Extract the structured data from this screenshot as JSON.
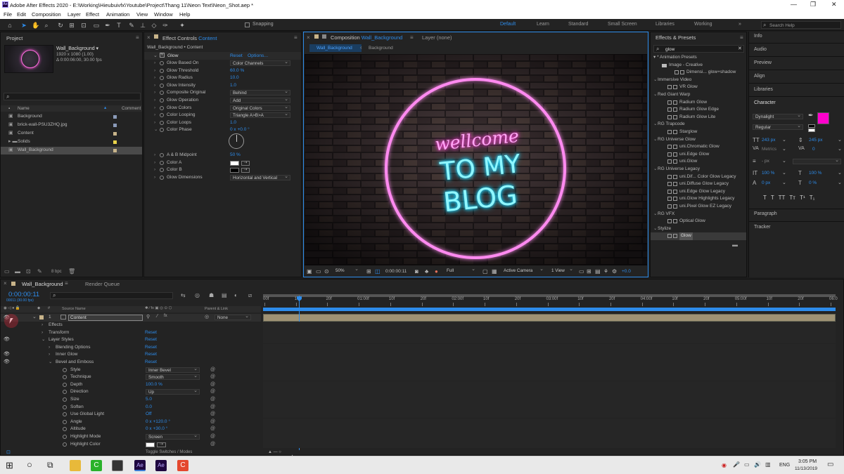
{
  "title_bar": {
    "text": "Adobe After Effects 2020 - E:\\Working\\Hieubuivfx\\Youtube\\Project\\Thang 11\\Neon Text\\Neon_Shot.aep *"
  },
  "menu": [
    "File",
    "Edit",
    "Composition",
    "Layer",
    "Effect",
    "Animation",
    "View",
    "Window",
    "Help"
  ],
  "toolbar": {
    "snapping": "Snapping",
    "workspaces": [
      "Default",
      "Learn",
      "Standard",
      "Small Screen",
      "Libraries",
      "Working"
    ],
    "search_placeholder": "Search Help"
  },
  "project": {
    "tab": "Project",
    "comp_name": "Wall_Background ▾",
    "comp_info1": "1920 x 1080 (1.00)",
    "comp_info2": "Δ 0:00:06:00, 30.00 fps",
    "col_name": "Name",
    "col_comment": "Comment",
    "items": [
      {
        "name": "Background",
        "color": "#8a9ab8"
      },
      {
        "name": "brick-wall-PSU3ZHQ.jpg",
        "color": "#8a9ab8"
      },
      {
        "name": "Content",
        "color": "#c8b48a"
      },
      {
        "name": "Solids",
        "color": "#e8d24a"
      },
      {
        "name": "Wall_Background",
        "color": "#c8b48a"
      }
    ],
    "bpc": "8 bpc"
  },
  "effect_controls": {
    "tab": "Effect Controls",
    "layer": "Content",
    "path": "Wall_Background • Content",
    "effect": "Glow",
    "reset": "Reset",
    "options": "Options...",
    "rows": [
      {
        "label": "Glow Based On",
        "value": "Color Channels",
        "kind": "dd"
      },
      {
        "label": "Glow Threshold",
        "value": "60.0 %",
        "kind": "val"
      },
      {
        "label": "Glow Radius",
        "value": "10.0",
        "kind": "val"
      },
      {
        "label": "Glow Intensity",
        "value": "1.0",
        "kind": "val"
      },
      {
        "label": "Composite Original",
        "value": "Behind",
        "kind": "dd"
      },
      {
        "label": "Glow Operation",
        "value": "Add",
        "kind": "dd"
      },
      {
        "label": "Glow Colors",
        "value": "Original Colors",
        "kind": "dd"
      },
      {
        "label": "Color Looping",
        "value": "Triangle A>B>A",
        "kind": "dd"
      },
      {
        "label": "Color Loops",
        "value": "1.0",
        "kind": "val"
      },
      {
        "label": "Color Phase",
        "value": "0 x +0.0 °",
        "kind": "val"
      }
    ],
    "rows2": [
      {
        "label": "A & B Midpoint",
        "value": "50 %",
        "kind": "val"
      },
      {
        "label": "Color A",
        "value": "",
        "kind": "swatch",
        "color": "#ffffff"
      },
      {
        "label": "Color B",
        "value": "",
        "kind": "swatch",
        "color": "#000000"
      },
      {
        "label": "Glow Dimensions",
        "value": "Horizontal and Vertical",
        "kind": "dd"
      }
    ]
  },
  "composition": {
    "tab_prefix": "Composition",
    "tab_name": "Wall_Background",
    "layer_tab": "Layer (none)",
    "crumbs": [
      "Wall_Background",
      "Background"
    ],
    "neon_line1": "wellcome",
    "neon_line2": "TO MY",
    "neon_line3": "BLOG",
    "zoom": "50%",
    "timecode": "0:00:00:11",
    "quality": "Full",
    "camera": "Active Camera",
    "views": "1 View",
    "exposure": "+0.0"
  },
  "effects_presets": {
    "tab": "Effects & Presets",
    "search": "glow",
    "tree": [
      {
        "t": "▾ * Animation Presets",
        "lvl": 0
      },
      {
        "t": "Image - Creative",
        "lvl": 1,
        "folder": true
      },
      {
        "t": "Dimensi... glow+shadow",
        "lvl": 2,
        "fx": true
      },
      {
        "t": "Immersive Video",
        "lvl": 0
      },
      {
        "t": "VR Glow",
        "lvl": 1,
        "fx": true
      },
      {
        "t": "Red Giant Warp",
        "lvl": 0
      },
      {
        "t": "Radium Glow",
        "lvl": 1,
        "fx": true
      },
      {
        "t": "Radium Glow Edge",
        "lvl": 1,
        "fx": true
      },
      {
        "t": "Radium Glow Lite",
        "lvl": 1,
        "fx": true
      },
      {
        "t": "RG Trapcode",
        "lvl": 0
      },
      {
        "t": "Starglow",
        "lvl": 1,
        "fx": true
      },
      {
        "t": "RG Universe Glow",
        "lvl": 0
      },
      {
        "t": "uni.Chromatic Glow",
        "lvl": 1,
        "fx": true
      },
      {
        "t": "uni.Edge Glow",
        "lvl": 1,
        "fx": true
      },
      {
        "t": "uni.Glow",
        "lvl": 1,
        "fx": true
      },
      {
        "t": "RG Universe Legacy",
        "lvl": 0
      },
      {
        "t": "uni.Dif... Color Glow Legacy",
        "lvl": 1,
        "fx": true
      },
      {
        "t": "uni.Diffuse Glow Legacy",
        "lvl": 1,
        "fx": true
      },
      {
        "t": "uni.Edge Glow Legacy",
        "lvl": 1,
        "fx": true
      },
      {
        "t": "uni.Glow Highlights Legacy",
        "lvl": 1,
        "fx": true
      },
      {
        "t": "uni.Pixel Glow EZ Legacy",
        "lvl": 1,
        "fx": true
      },
      {
        "t": "RG VFX",
        "lvl": 0
      },
      {
        "t": "Optical Glow",
        "lvl": 1,
        "fx": true
      },
      {
        "t": "Stylize",
        "lvl": 0
      },
      {
        "t": "Glow",
        "lvl": 1,
        "fx": true,
        "sel": true
      }
    ]
  },
  "right_panels": {
    "info": "Info",
    "audio": "Audio",
    "preview": "Preview",
    "align": "Align",
    "libraries": "Libraries",
    "character": "Character",
    "font": "Dynalight",
    "style": "Regular",
    "size": "243",
    "size_unit": "px",
    "leading": "245",
    "leading_unit": "px",
    "metrics": "Metrics",
    "tracking": "0",
    "stroke_unit": "- px",
    "vscale": "100 %",
    "hscale": "100 %",
    "baseline": "0 px",
    "tsume": "0 %",
    "paragraph": "Paragraph",
    "tracker": "Tracker",
    "fill_color": "#ff00cc"
  },
  "timeline": {
    "tab": "Wall_Background",
    "render_queue": "Render Queue",
    "timecode": "0:00:00:11",
    "frames": "00011 (30.00 fps)",
    "col_source": "Source Name",
    "col_parent": "Parent & Link",
    "layer_num": "1",
    "layer_name": "Content",
    "parent": "None",
    "ruler": [
      "00f",
      "10f",
      "20f",
      "01:00f",
      "10f",
      "20f",
      "02:00f",
      "10f",
      "20f",
      "03:00f",
      "10f",
      "20f",
      "04:00f",
      "10f",
      "20f",
      "05:00f",
      "10f",
      "20f",
      "06:0"
    ],
    "props": [
      {
        "label": "Effects",
        "lvl": 1,
        "arrow": "›"
      },
      {
        "label": "Transform",
        "lvl": 1,
        "arrow": "›",
        "reset": "Reset"
      },
      {
        "label": "Layer Styles",
        "lvl": 1,
        "arrow": "⌄",
        "reset": "Reset",
        "eye": true
      },
      {
        "label": "Blending Options",
        "lvl": 2,
        "arrow": "›",
        "reset": "Reset"
      },
      {
        "label": "Inner Glow",
        "lvl": 2,
        "arrow": "›",
        "reset": "Reset",
        "eye": true
      },
      {
        "label": "Bevel and Emboss",
        "lvl": 2,
        "arrow": "⌄",
        "reset": "Reset",
        "eye": true
      },
      {
        "label": "Style",
        "lvl": 3,
        "dd": "Inner Bevel"
      },
      {
        "label": "Technique",
        "lvl": 3,
        "dd": "Smooth"
      },
      {
        "label": "Depth",
        "lvl": 3,
        "val": "100.0 %"
      },
      {
        "label": "Direction",
        "lvl": 3,
        "dd": "Up"
      },
      {
        "label": "Size",
        "lvl": 3,
        "val": "5.0"
      },
      {
        "label": "Soften",
        "lvl": 3,
        "val": "0.0"
      },
      {
        "label": "Use Global Light",
        "lvl": 3,
        "val": "Off"
      },
      {
        "label": "Angle",
        "lvl": 3,
        "val": "0 x +120.0 °"
      },
      {
        "label": "Altitude",
        "lvl": 3,
        "val": "0 x +30.0 °"
      },
      {
        "label": "Highlight Mode",
        "lvl": 3,
        "dd": "Screen"
      },
      {
        "label": "Highlight Color",
        "lvl": 3,
        "swatch": "#ffffff"
      }
    ],
    "toggle": "Toggle Switches / Modes"
  },
  "taskbar": {
    "lang": "ENG",
    "time": "3:05 PM",
    "date": "11/13/2019"
  }
}
